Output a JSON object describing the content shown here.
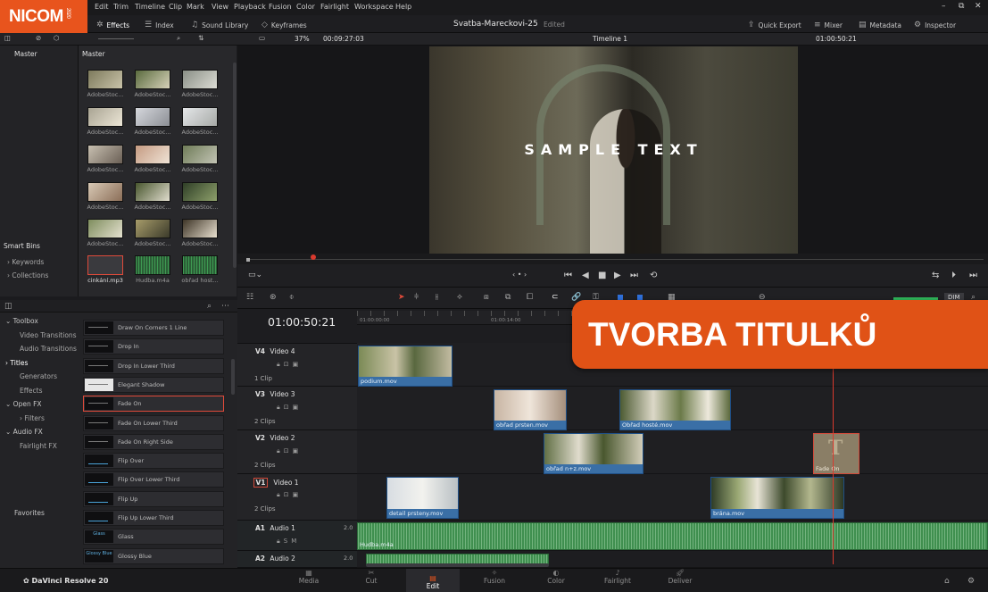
{
  "app": {
    "logo": "NICOM",
    "logo_sub": "2020",
    "project_name": "Svatba-Mareckovi-25",
    "edited_label": "Edited",
    "brand": "DaVinci Resolve 20"
  },
  "menu": [
    "Edit",
    "Trim",
    "Timeline",
    "Clip",
    "Mark",
    "View",
    "Playback",
    "Fusion",
    "Color",
    "Fairlight",
    "Workspace",
    "Help"
  ],
  "toolbar": {
    "effects": "Effects",
    "index": "Index",
    "sound_library": "Sound Library",
    "keyframes": "Keyframes",
    "quick_export": "Quick Export",
    "mixer": "Mixer",
    "metadata": "Metadata",
    "inspector": "Inspector"
  },
  "viewer_bar": {
    "zoom": "37%",
    "duration": "00:09:27:03",
    "timeline_name": "Timeline 1",
    "timecode": "01:00:50:21"
  },
  "bins": {
    "master": "Master",
    "smart_bins": "Smart Bins",
    "keywords": "Keywords",
    "collections": "Collections"
  },
  "media_pool": {
    "title": "Master",
    "clips": [
      {
        "label": "AdobeStoc...",
        "c1": "#7d7a5c",
        "c2": "#c9c3a9"
      },
      {
        "label": "AdobeStoc...",
        "c1": "#5a6b3e",
        "c2": "#d6d1b8"
      },
      {
        "label": "AdobeStoc...",
        "c1": "#8a8f86",
        "c2": "#dcdcd4"
      },
      {
        "label": "AdobeStoc...",
        "c1": "#a9a493",
        "c2": "#ece6d6"
      },
      {
        "label": "AdobeStoc...",
        "c1": "#d5d7dc",
        "c2": "#8c8f95"
      },
      {
        "label": "AdobeStoc...",
        "c1": "#e4e6e8",
        "c2": "#a7aaa7"
      },
      {
        "label": "AdobeStoc...",
        "c1": "#c8c0b1",
        "c2": "#6a5f55"
      },
      {
        "label": "AdobeStoc...",
        "c1": "#c59b82",
        "c2": "#efe3d6"
      },
      {
        "label": "AdobeStoc...",
        "c1": "#6f7c58",
        "c2": "#c2c3b4"
      },
      {
        "label": "AdobeStoc...",
        "c1": "#d8c9b5",
        "c2": "#8b6e58"
      },
      {
        "label": "AdobeStoc...",
        "c1": "#48562e",
        "c2": "#e0dccd"
      },
      {
        "label": "AdobeStoc...",
        "c1": "#2f3f27",
        "c2": "#8ea06b"
      },
      {
        "label": "AdobeStoc...",
        "c1": "#7e8d5d",
        "c2": "#e5e1d0"
      },
      {
        "label": "AdobeStoc...",
        "c1": "#a79c6a",
        "c2": "#3b3a2a"
      },
      {
        "label": "AdobeStoc...",
        "c1": "#3d3426",
        "c2": "#e8dfcf"
      }
    ],
    "audio": [
      {
        "label": "cinkání.mp3"
      },
      {
        "label": "Hudba.m4a"
      },
      {
        "label": "obřad host..."
      }
    ]
  },
  "viewer": {
    "sample_text": "SAMPLE TEXT"
  },
  "effects": {
    "tree": [
      {
        "label": "Toolbox",
        "level": 0,
        "arrow": "⌄"
      },
      {
        "label": "Video Transitions",
        "level": 1
      },
      {
        "label": "Audio Transitions",
        "level": 1
      },
      {
        "label": "Titles",
        "level": 0,
        "arrow": "›",
        "selected": true
      },
      {
        "label": "Generators",
        "level": 1
      },
      {
        "label": "Effects",
        "level": 1
      },
      {
        "label": "Open FX",
        "level": 0,
        "arrow": "⌄"
      },
      {
        "label": "Filters",
        "level": 1,
        "arrow": "›"
      },
      {
        "label": "Audio FX",
        "level": 0,
        "arrow": "⌄"
      },
      {
        "label": "Fairlight FX",
        "level": 1
      }
    ],
    "favorites": "Favorites",
    "items": [
      {
        "label": "Draw On Corners 1 Line",
        "thumb": ""
      },
      {
        "label": "Drop In",
        "thumb": ""
      },
      {
        "label": "Drop In Lower Third",
        "thumb": ""
      },
      {
        "label": "Elegant Shadow",
        "thumb": ""
      },
      {
        "label": "Fade On",
        "thumb": "",
        "selected": true
      },
      {
        "label": "Fade On Lower Third",
        "thumb": ""
      },
      {
        "label": "Fade On Right Side",
        "thumb": ""
      },
      {
        "label": "Flip Over",
        "thumb": ""
      },
      {
        "label": "Flip Over Lower Third",
        "thumb": ""
      },
      {
        "label": "Flip Up",
        "thumb": ""
      },
      {
        "label": "Flip Up Lower Third",
        "thumb": ""
      },
      {
        "label": "Glass",
        "thumb": "Glass"
      },
      {
        "label": "Glossy Blue",
        "thumb": "Glossy Blue"
      }
    ]
  },
  "timeline": {
    "timecode": "01:00:50:21",
    "ruler": [
      "01:00:00:00",
      "01:00:14:00"
    ],
    "dim_label": "DIM",
    "tracks": [
      {
        "id": "V4",
        "name": "Video 4",
        "count": "1 Clip"
      },
      {
        "id": "V3",
        "name": "Video 3",
        "count": "2 Clips"
      },
      {
        "id": "V2",
        "name": "Video 2",
        "count": "2 Clips"
      },
      {
        "id": "V1",
        "name": "Video 1",
        "count": "2 Clips"
      },
      {
        "id": "A1",
        "name": "Audio 1",
        "level": "2.0"
      },
      {
        "id": "A2",
        "name": "Audio 2",
        "level": "2.0"
      }
    ],
    "clips": {
      "podium": "podium.mov",
      "obrad_prsten": "obřad prsten.mov",
      "obrad_hoste": "Obřad hosté.mov",
      "obrad_nz": "obřad n+z.mov",
      "fade_on": "Fade On",
      "detail_prsteny": "detail prsteny.mov",
      "brana": "brána.mov",
      "hudba": "Hudba.m4a"
    }
  },
  "banner": "TVORBA TITULKŮ",
  "pages": [
    "Media",
    "Cut",
    "Edit",
    "Fusion",
    "Color",
    "Fairlight",
    "Deliver"
  ],
  "active_page": "Edit",
  "colors": {
    "accent": "#e05216",
    "clip_blue": "#3a6fa6",
    "audio_green": "#3f8f4f",
    "playhead": "#d93a2e"
  }
}
